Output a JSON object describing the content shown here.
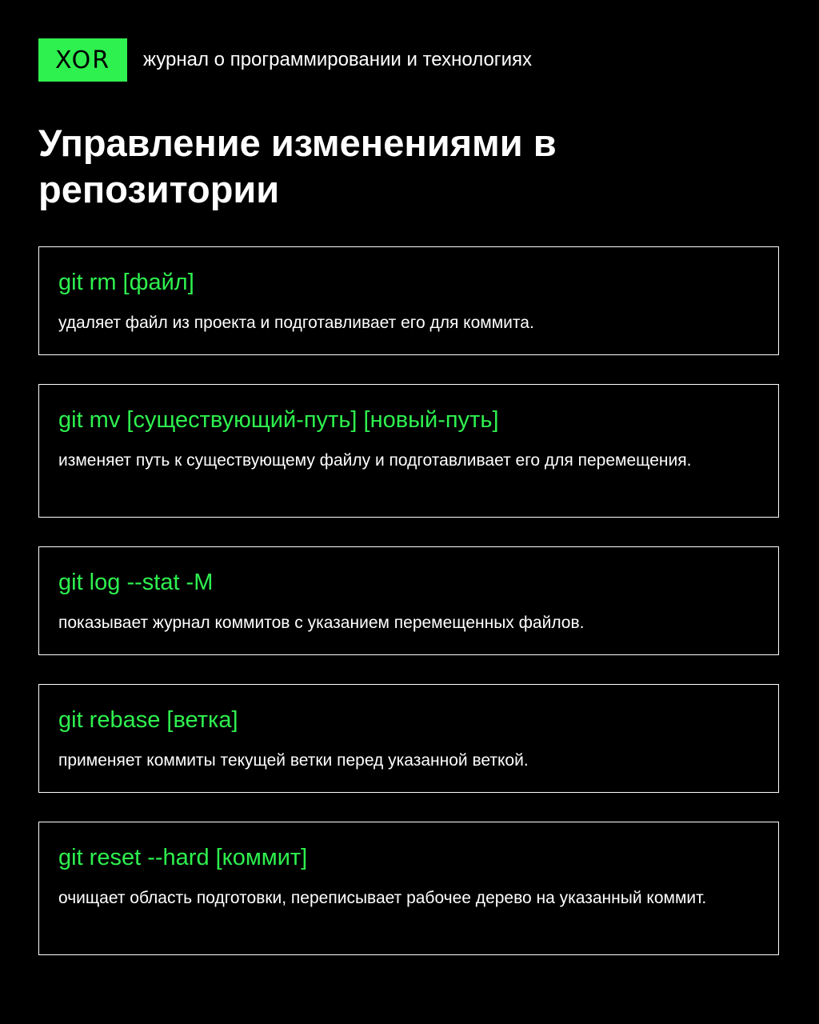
{
  "header": {
    "logo_text": "XOR",
    "tagline": "журнал о программировании и технологиях"
  },
  "title": "Управление изменениями в репозитории",
  "colors": {
    "background": "#000000",
    "accent": "#2ef04f",
    "text": "#ffffff"
  },
  "commands": [
    {
      "command": "git rm [файл]",
      "description": "удаляет файл из проекта и подготавливает его для коммита."
    },
    {
      "command": "git mv [существующий-путь] [новый-путь]",
      "description": "изменяет путь к существующему файлу и подготавливает его для перемещения."
    },
    {
      "command": "git log --stat -M",
      "description": "показывает журнал коммитов с указанием перемещенных файлов."
    },
    {
      "command": "git rebase [ветка]",
      "description": "применяет коммиты текущей ветки перед указанной веткой."
    },
    {
      "command": "git reset --hard [коммит]",
      "description": "очищает область подготовки, переписывает рабочее дерево на указанный коммит."
    }
  ]
}
